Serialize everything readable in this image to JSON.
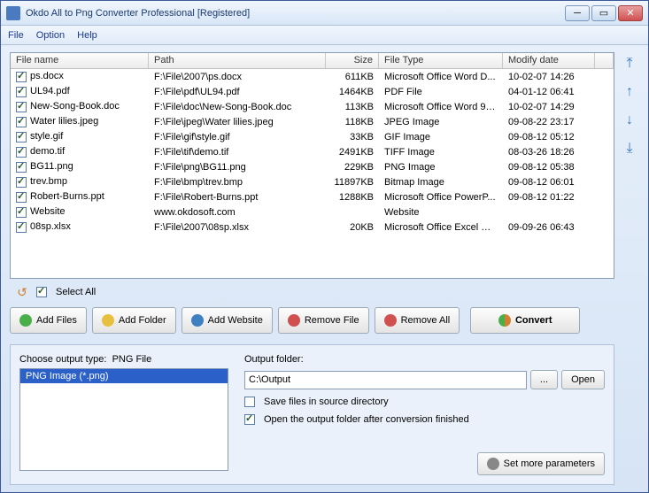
{
  "window": {
    "title": "Okdo All to Png Converter Professional [Registered]"
  },
  "menu": {
    "file": "File",
    "option": "Option",
    "help": "Help"
  },
  "columns": {
    "name": "File name",
    "path": "Path",
    "size": "Size",
    "type": "File Type",
    "date": "Modify date"
  },
  "files": [
    {
      "name": "ps.docx",
      "path": "F:\\File\\2007\\ps.docx",
      "size": "611KB",
      "type": "Microsoft Office Word D...",
      "date": "10-02-07 14:26"
    },
    {
      "name": "UL94.pdf",
      "path": "F:\\File\\pdf\\UL94.pdf",
      "size": "1464KB",
      "type": "PDF File",
      "date": "04-01-12 06:41"
    },
    {
      "name": "New-Song-Book.doc",
      "path": "F:\\File\\doc\\New-Song-Book.doc",
      "size": "113KB",
      "type": "Microsoft Office Word 97...",
      "date": "10-02-07 14:29"
    },
    {
      "name": "Water lilies.jpeg",
      "path": "F:\\File\\jpeg\\Water lilies.jpeg",
      "size": "118KB",
      "type": "JPEG Image",
      "date": "09-08-22 23:17"
    },
    {
      "name": "style.gif",
      "path": "F:\\File\\gif\\style.gif",
      "size": "33KB",
      "type": "GIF Image",
      "date": "09-08-12 05:12"
    },
    {
      "name": "demo.tif",
      "path": "F:\\File\\tif\\demo.tif",
      "size": "2491KB",
      "type": "TIFF Image",
      "date": "08-03-26 18:26"
    },
    {
      "name": "BG11.png",
      "path": "F:\\File\\png\\BG11.png",
      "size": "229KB",
      "type": "PNG Image",
      "date": "09-08-12 05:38"
    },
    {
      "name": "trev.bmp",
      "path": "F:\\File\\bmp\\trev.bmp",
      "size": "11897KB",
      "type": "Bitmap Image",
      "date": "09-08-12 06:01"
    },
    {
      "name": "Robert-Burns.ppt",
      "path": "F:\\File\\Robert-Burns.ppt",
      "size": "1288KB",
      "type": "Microsoft Office PowerP...",
      "date": "09-08-12 01:22"
    },
    {
      "name": "Website",
      "path": "www.okdosoft.com",
      "size": "",
      "type": "Website",
      "date": ""
    },
    {
      "name": "08sp.xlsx",
      "path": "F:\\File\\2007\\08sp.xlsx",
      "size": "20KB",
      "type": "Microsoft Office Excel W...",
      "date": "09-09-26 06:43"
    }
  ],
  "selectAll": "Select All",
  "buttons": {
    "addFiles": "Add Files",
    "addFolder": "Add Folder",
    "addWebsite": "Add Website",
    "removeFile": "Remove File",
    "removeAll": "Remove All",
    "convert": "Convert"
  },
  "output": {
    "chooseLabel": "Choose output type:",
    "typeValue": "PNG File",
    "listItem": "PNG Image (*.png)",
    "folderLabel": "Output folder:",
    "folderValue": "C:\\Output",
    "browse": "...",
    "open": "Open",
    "saveSource": "Save files in source directory",
    "openAfter": "Open the output folder after conversion finished",
    "more": "Set more parameters"
  }
}
